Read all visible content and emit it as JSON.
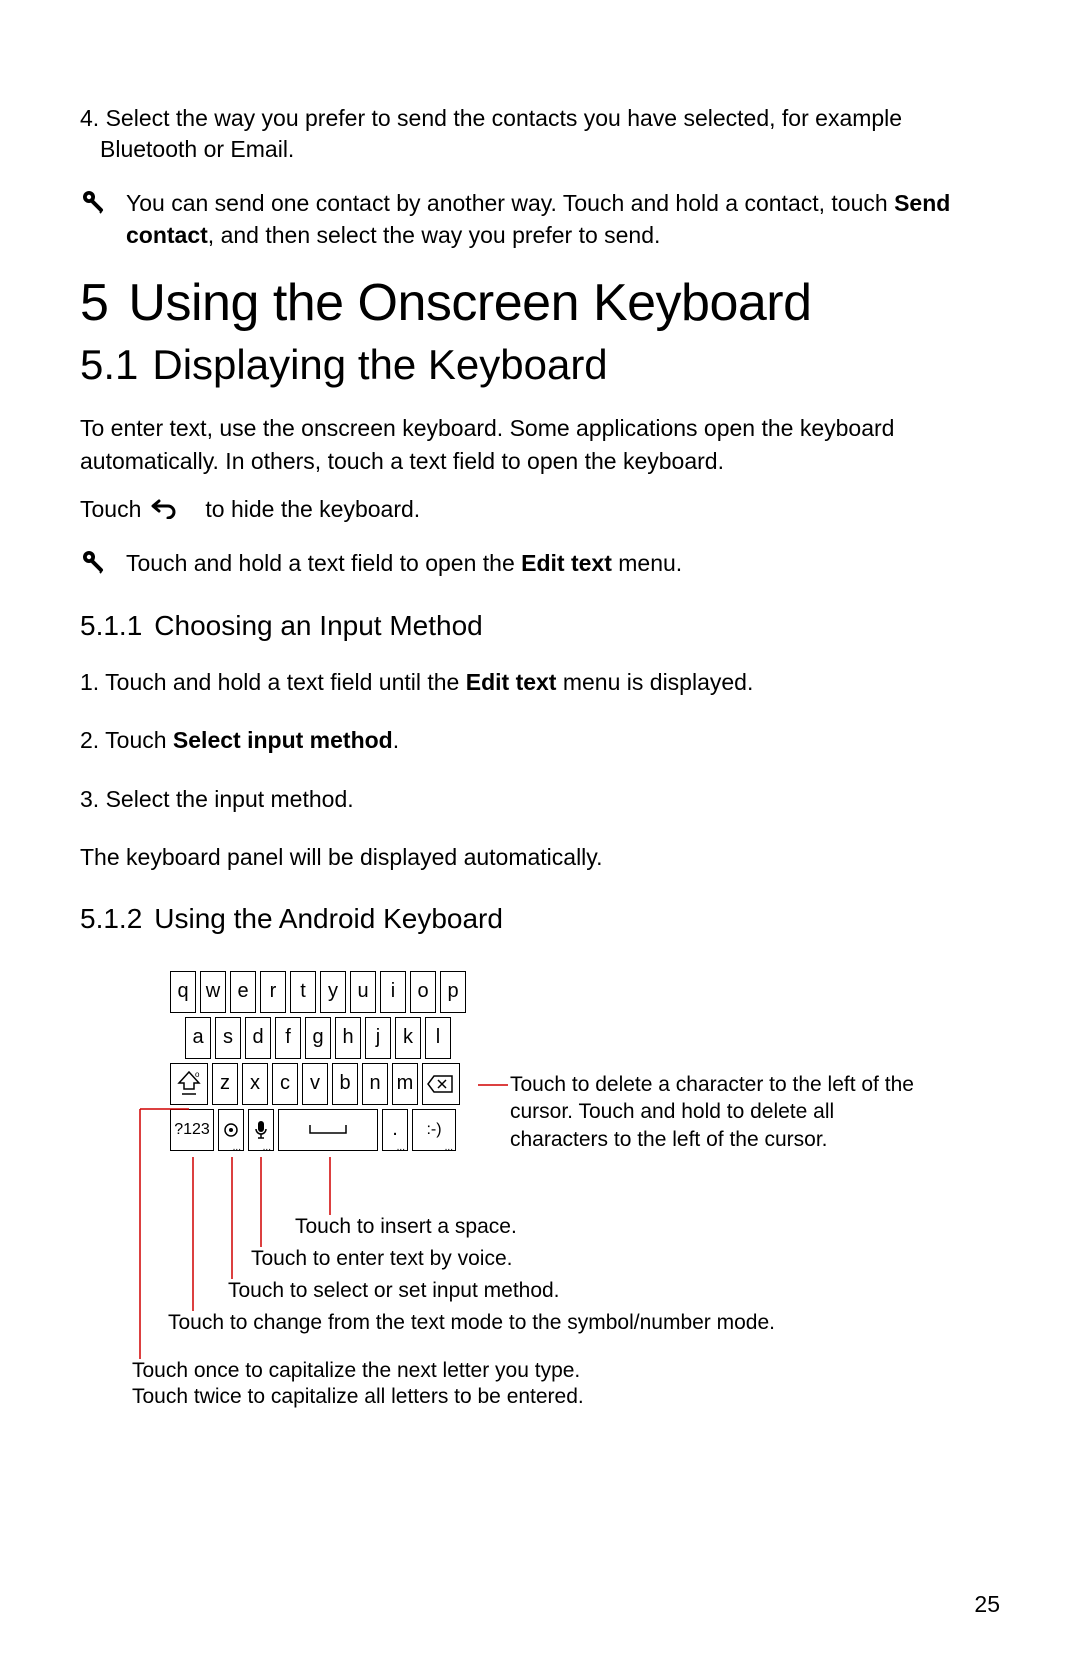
{
  "step4_prefix": "4. Select the way you prefer to send the contacts you have selected, for example Bluetooth or Email.",
  "tip1_pre": "You can send one contact by another way. Touch and hold a contact, touch ",
  "tip1_bold": "Send contact",
  "tip1_post": ", and then select the way you prefer to send.",
  "chapter_num": "5",
  "chapter_title": "Using the Onscreen Keyboard",
  "section_num": "5.1",
  "section_title": "Displaying the Keyboard",
  "para1": "To enter text, use the onscreen keyboard. Some applications open the keyboard automatically. In others, touch a text field to open the keyboard.",
  "touch_pre": "Touch",
  "touch_post": "to hide the keyboard.",
  "tip2_pre": "Touch and hold a text field to open the ",
  "tip2_bold": "Edit text",
  "tip2_post": " menu.",
  "sub1_num": "5.1.1",
  "sub1_title": "Choosing an Input Method",
  "s1_step1_pre": "1. Touch and hold a text field until the ",
  "s1_step1_bold": "Edit text",
  "s1_step1_post": " menu is displayed.",
  "s1_step2_pre": "2. Touch ",
  "s1_step2_bold": "Select input method",
  "s1_step2_post": ".",
  "s1_step3": "3. Select the input method.",
  "s1_outro": "The keyboard panel will be displayed automatically.",
  "sub2_num": "5.1.2",
  "sub2_title": "Using the Android Keyboard",
  "kb_row1": [
    "q",
    "w",
    "e",
    "r",
    "t",
    "y",
    "u",
    "i",
    "o",
    "p"
  ],
  "kb_row2": [
    "a",
    "s",
    "d",
    "f",
    "g",
    "h",
    "j",
    "k",
    "l"
  ],
  "kb_row3": [
    "z",
    "x",
    "c",
    "v",
    "b",
    "n",
    "m"
  ],
  "kb_numkey": "?123",
  "kb_period": ".",
  "kb_smile": ":-)",
  "ann_del": "Touch to delete a character to the left of the cursor. Touch and hold to delete all characters to the left of the cursor.",
  "ann_space": "Touch to insert a space.",
  "ann_voice": "Touch to enter text by voice.",
  "ann_method": "Touch to select or set input method.",
  "ann_mode": "Touch to change from the text mode to the symbol/number mode.",
  "ann_cap1": "Touch once to capitalize the next letter you type.",
  "ann_cap2": "Touch twice to capitalize all letters to be entered.",
  "page_number": "25"
}
